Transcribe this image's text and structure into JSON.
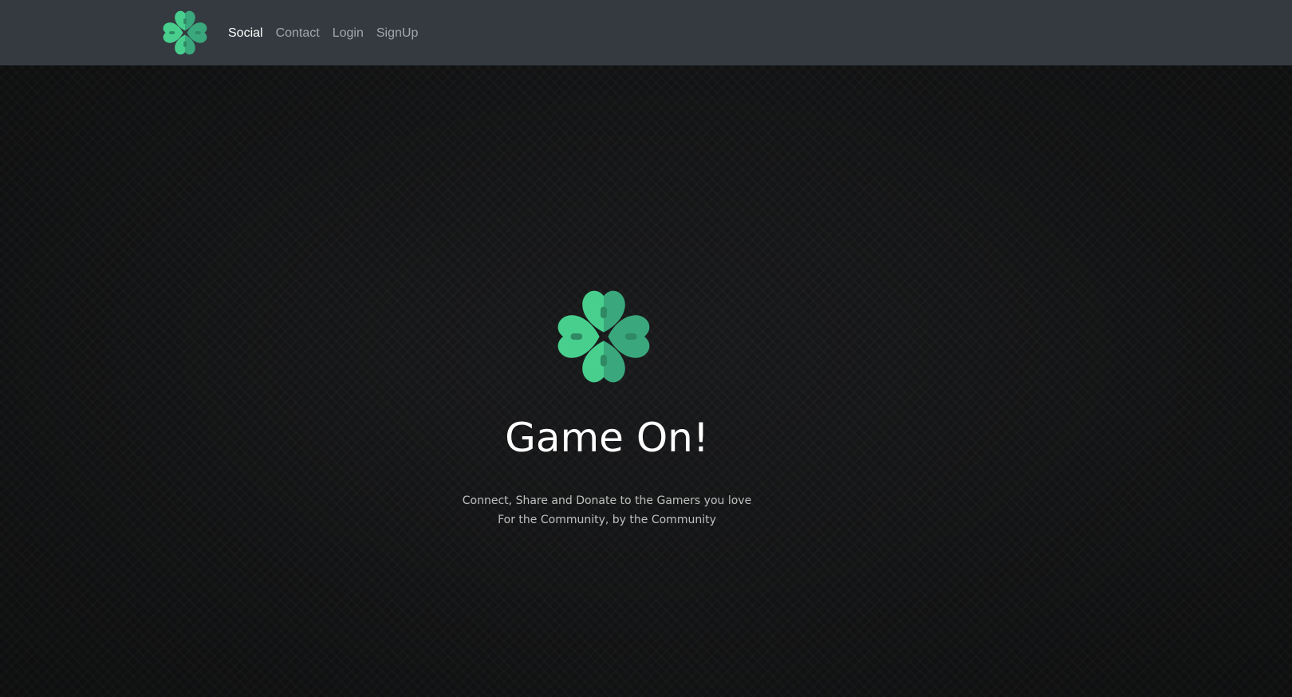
{
  "nav": {
    "links": [
      {
        "label": "Social"
      },
      {
        "label": "Contact"
      },
      {
        "label": "Login"
      },
      {
        "label": "SignUp"
      }
    ]
  },
  "hero": {
    "title": "Game On!",
    "subtitle_line1": "Connect, Share and Donate to the Gamers you love",
    "subtitle_line2": "For the Community, by the Community"
  },
  "colors": {
    "navbar": "#343a40",
    "brand_green_light": "#48cf8e",
    "brand_green_dark": "#3aa77d",
    "background": "#151617"
  },
  "icons": {
    "brand": "clover-gamepad-logo-icon"
  }
}
